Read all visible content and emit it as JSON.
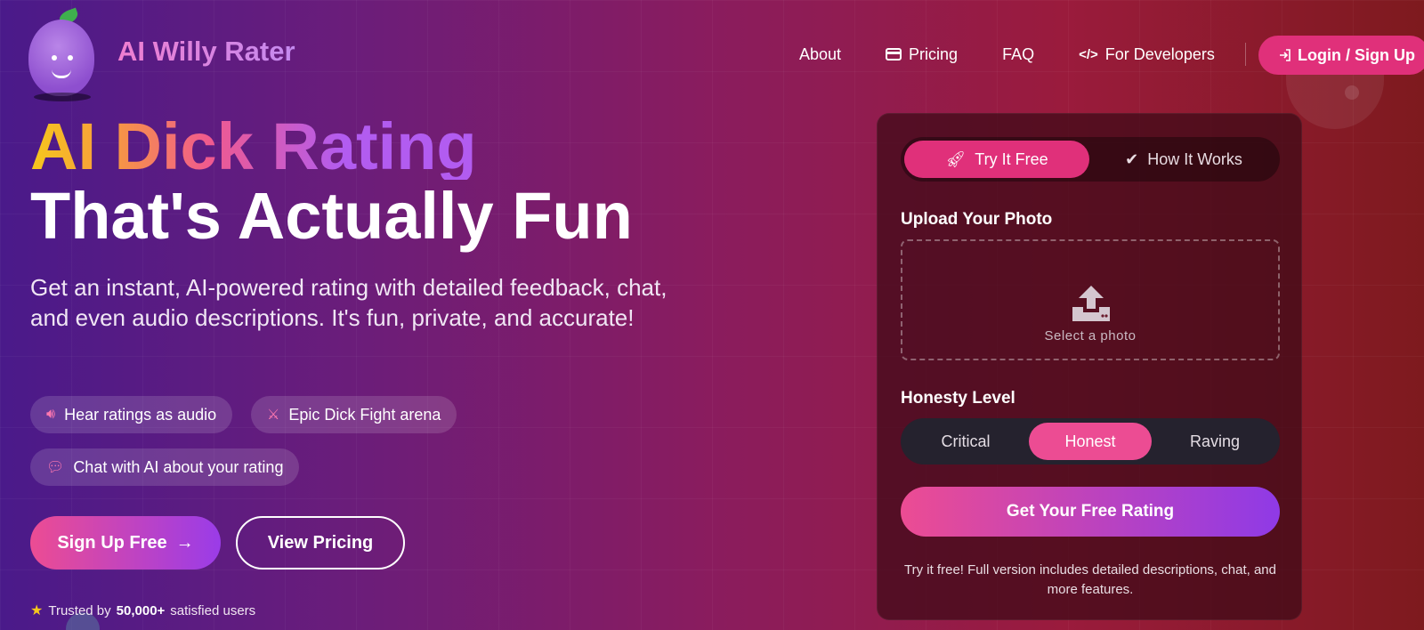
{
  "brand": {
    "name": "AI Willy Rater"
  },
  "nav": {
    "about": "About",
    "pricing": "Pricing",
    "faq": "FAQ",
    "developers": "For Developers",
    "login": "Login / Sign Up"
  },
  "hero": {
    "title_line1": "AI Dick Rating",
    "title_line2": "That's Actually Fun",
    "subtitle": "Get an instant, AI-powered rating with detailed feedback, chat, and even audio descriptions. It's fun, private, and accurate!",
    "chips": [
      {
        "icon": "speaker-icon",
        "label": "Hear ratings as audio"
      },
      {
        "icon": "swords-icon",
        "label": "Epic Dick Fight arena"
      },
      {
        "icon": "chat-icon",
        "label": "Chat with AI about your rating"
      }
    ],
    "signup_label": "Sign Up Free",
    "pricing_label": "View Pricing",
    "trust_prefix": "Trusted by",
    "trust_count": "50,000+",
    "trust_suffix": "satisfied users"
  },
  "card": {
    "tabs": [
      {
        "label": "Try It Free",
        "active": true
      },
      {
        "label": "How It Works",
        "active": false
      }
    ],
    "upload_label": "Upload Your Photo",
    "upload_placeholder": "Select a photo",
    "honesty_label": "Honesty Level",
    "levels": [
      {
        "label": "Critical",
        "selected": false
      },
      {
        "label": "Honest",
        "selected": true
      },
      {
        "label": "Raving",
        "selected": false
      }
    ],
    "cta": "Get Your Free Rating",
    "note": "Try it free! Full version includes detailed descriptions, chat, and more features."
  },
  "colors": {
    "accent_pink": "#e0307a",
    "accent_purple": "#8f3ae6",
    "star_yellow": "#f6c81c"
  }
}
